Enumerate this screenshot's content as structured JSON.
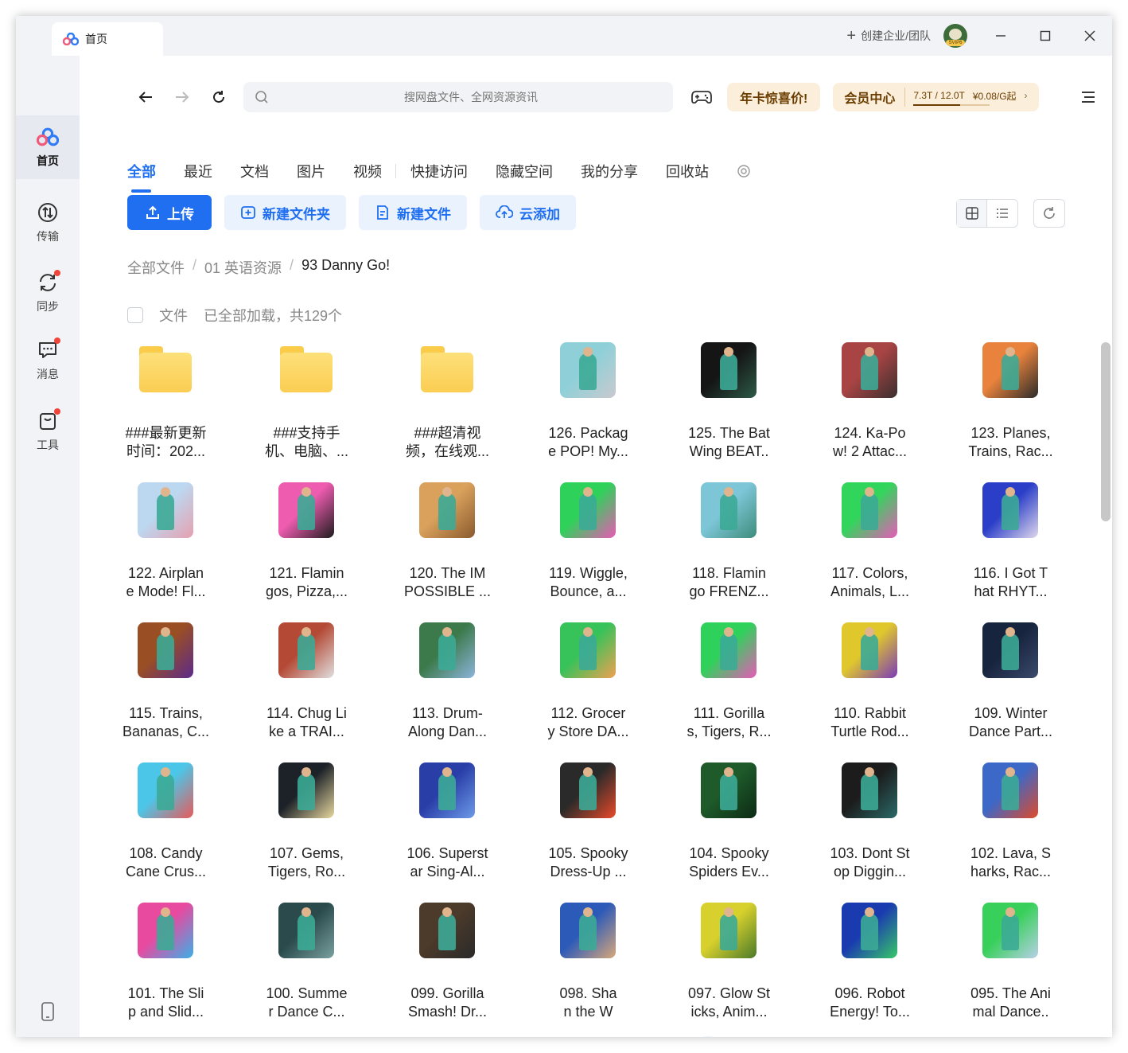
{
  "window": {
    "tab_label": "首页",
    "create_team_label": "创建企业/团队",
    "avatar_badge": "SVIP6"
  },
  "sidebar": {
    "items": [
      {
        "label": "首页",
        "icon": "baidu-netdisk-logo-icon",
        "active": true,
        "badge": false
      },
      {
        "label": "传输",
        "icon": "transfer-icon",
        "active": false,
        "badge": false
      },
      {
        "label": "同步",
        "icon": "sync-icon",
        "active": false,
        "badge": true
      },
      {
        "label": "消息",
        "icon": "message-icon",
        "active": false,
        "badge": true
      },
      {
        "label": "工具",
        "icon": "tools-icon",
        "active": false,
        "badge": true
      }
    ]
  },
  "toolbar": {
    "search_placeholder": "搜网盘文件、全网资源资讯",
    "promo_label": "年卡惊喜价!",
    "vip_label": "会员中心",
    "storage_text": "7.3T / 12.0T",
    "storage_used_fraction": 0.61,
    "price_text": "¥0.08/G起"
  },
  "categories": [
    "全部",
    "最近",
    "文档",
    "图片",
    "视频",
    "快捷访问",
    "隐藏空间",
    "我的分享",
    "回收站"
  ],
  "active_category": "全部",
  "actions": {
    "upload": "上传",
    "new_folder": "新建文件夹",
    "new_file": "新建文件",
    "cloud_add": "云添加"
  },
  "breadcrumb": [
    "全部文件",
    "01 英语资源",
    "93 Danny Go!"
  ],
  "summary": {
    "label": "文件",
    "status": "已全部加载，共129个"
  },
  "files": [
    {
      "name": "###最新更新\n时间：202...",
      "type": "folder"
    },
    {
      "name": "###支持手\n机、电脑、...",
      "type": "folder"
    },
    {
      "name": "###超清视\n频，在线观...",
      "type": "folder"
    },
    {
      "name": "126. Packag\ne POP! My...",
      "type": "video",
      "colors": [
        "#8fd0d8",
        "#c9c9cf"
      ]
    },
    {
      "name": "125. The Bat\nWing BEAT..",
      "type": "video",
      "colors": [
        "#151515",
        "#2d5a48"
      ]
    },
    {
      "name": "124. Ka-Po\nw! 2 Attac...",
      "type": "video",
      "colors": [
        "#a94444",
        "#3a2f2f"
      ]
    },
    {
      "name": "123. Planes,\nTrains, Rac...",
      "type": "video",
      "colors": [
        "#e8823c",
        "#2a2a2a"
      ]
    },
    {
      "name": "122. Airplan\ne Mode! Fl...",
      "type": "video",
      "colors": [
        "#bcd8f0",
        "#e6a0b0"
      ]
    },
    {
      "name": "121. Flamin\ngos, Pizza,...",
      "type": "video",
      "colors": [
        "#ee5cb0",
        "#1c1c1c"
      ]
    },
    {
      "name": "120. The IM\nPOSSIBLE ...",
      "type": "video",
      "colors": [
        "#d9a15c",
        "#8a5a2e"
      ]
    },
    {
      "name": "119. Wiggle,\nBounce, a...",
      "type": "video",
      "colors": [
        "#2ed25a",
        "#ea58b4"
      ]
    },
    {
      "name": "118. Flamin\ngo FRENZ...",
      "type": "video",
      "colors": [
        "#7cc6d8",
        "#3e8c7a"
      ]
    },
    {
      "name": "117. Colors,\nAnimals, L...",
      "type": "video",
      "colors": [
        "#32d55c",
        "#e85ab8"
      ]
    },
    {
      "name": "116. I Got T\nhat RHYT...",
      "type": "video",
      "colors": [
        "#2a3ec8",
        "#e0d8ec"
      ]
    },
    {
      "name": "115. Trains,\nBananas, C...",
      "type": "video",
      "colors": [
        "#9a4e24",
        "#5c2a8c"
      ]
    },
    {
      "name": "114. Chug Li\nke a TRAI...",
      "type": "video",
      "colors": [
        "#b44a36",
        "#e0e0e0"
      ]
    },
    {
      "name": "113. Drum-\nAlong Dan...",
      "type": "video",
      "colors": [
        "#3c7a4c",
        "#8db4dc"
      ]
    },
    {
      "name": "112. Grocer\ny Store DA...",
      "type": "video",
      "colors": [
        "#38c25a",
        "#f0a050"
      ]
    },
    {
      "name": "111. Gorilla\ns, Tigers, R...",
      "type": "video",
      "colors": [
        "#2ed25a",
        "#e85ab8"
      ]
    },
    {
      "name": "110. Rabbit\nTurtle Rod...",
      "type": "video",
      "colors": [
        "#e0c82c",
        "#7a3ab8"
      ]
    },
    {
      "name": "109. Winter\nDance Part...",
      "type": "video",
      "colors": [
        "#16243e",
        "#3c4a6c"
      ]
    },
    {
      "name": "108. Candy\nCane Crus...",
      "type": "video",
      "colors": [
        "#4cc6e8",
        "#e85a5a"
      ]
    },
    {
      "name": "107. Gems,\nTigers, Ro...",
      "type": "video",
      "colors": [
        "#1c2228",
        "#e8d8a0"
      ]
    },
    {
      "name": "106. Superst\nar Sing-Al...",
      "type": "video",
      "colors": [
        "#2a3ea8",
        "#6c9ae8"
      ]
    },
    {
      "name": "105. Spooky\nDress-Up ...",
      "type": "video",
      "colors": [
        "#2a2a2a",
        "#e84a2a"
      ]
    },
    {
      "name": "104. Spooky\nSpiders Ev...",
      "type": "video",
      "colors": [
        "#1e5a2a",
        "#0c2a14"
      ]
    },
    {
      "name": "103. Dont St\nop Diggin...",
      "type": "video",
      "colors": [
        "#1c1c1c",
        "#2a6a68"
      ]
    },
    {
      "name": "102. Lava, S\nharks, Rac...",
      "type": "video",
      "colors": [
        "#3c68c8",
        "#e04a2a"
      ]
    },
    {
      "name": "101. The Sli\np and Slid...",
      "type": "video",
      "colors": [
        "#e84aa0",
        "#3ab0e8"
      ]
    },
    {
      "name": "100. Summe\nr Dance C...",
      "type": "video",
      "colors": [
        "#2a4a4c",
        "#7aa0a0"
      ]
    },
    {
      "name": "099. Gorilla\nSmash! Dr...",
      "type": "video",
      "colors": [
        "#4c3a2a",
        "#2a2a2a"
      ]
    },
    {
      "name": "098. Sha\nn the W",
      "type": "video",
      "colors": [
        "#2c5ab8",
        "#d8a87a"
      ]
    },
    {
      "name": "097. Glow St\nicks, Anim...",
      "type": "video",
      "colors": [
        "#d8d02c",
        "#4a7a2a"
      ]
    },
    {
      "name": "096. Robot\nEnergy! To...",
      "type": "video",
      "colors": [
        "#1a3ab0",
        "#38c868"
      ]
    },
    {
      "name": "095. The Ani\nmal Dance..",
      "type": "video",
      "colors": [
        "#38d05a",
        "#b8d0e8"
      ]
    }
  ],
  "colors": {
    "accent": "#1f6ff0",
    "promo_bg": "#fbefdc",
    "folder": "#fbcd52"
  }
}
